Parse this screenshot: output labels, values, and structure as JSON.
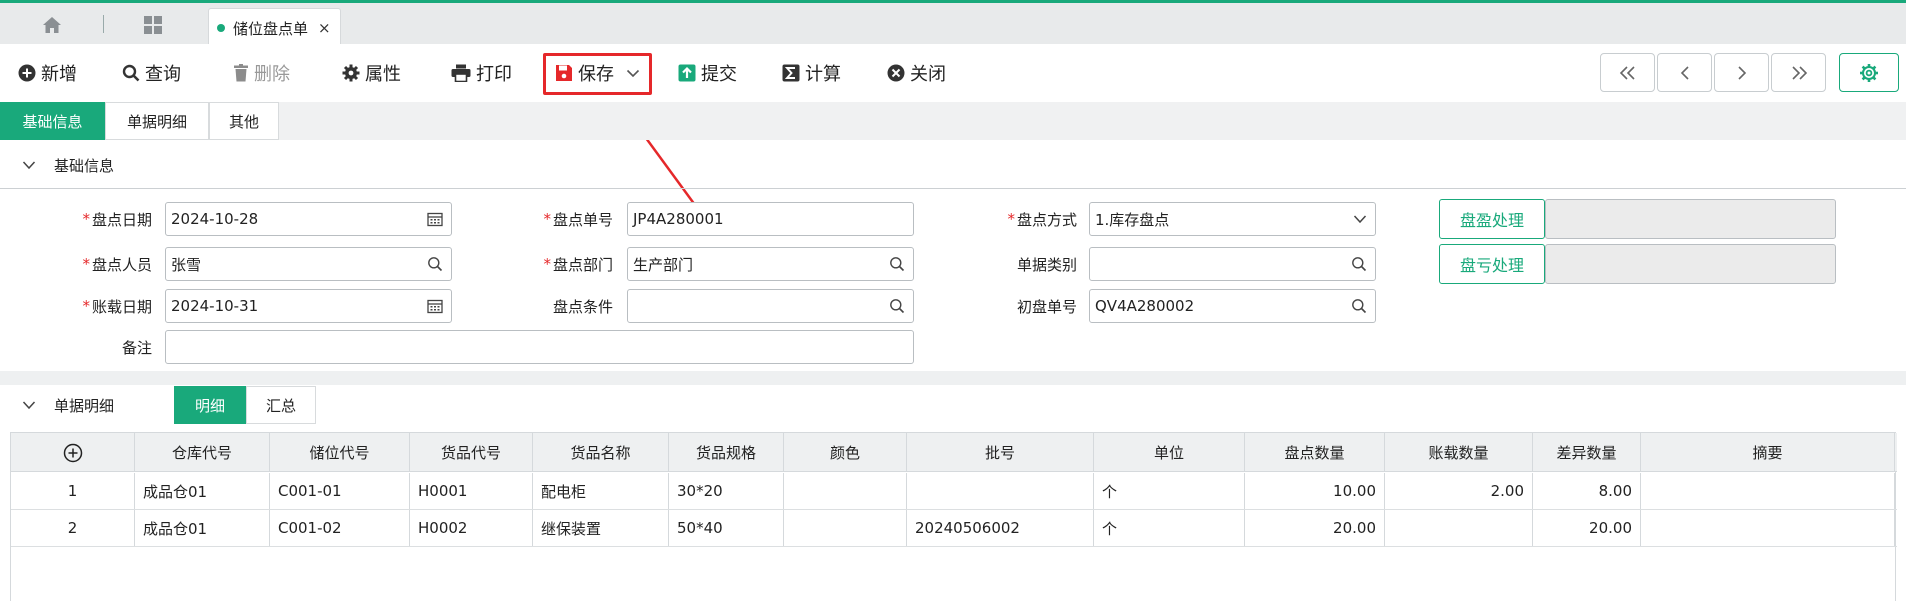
{
  "tabs": {
    "doc_tab_label": "储位盘点单",
    "close_glyph": "×"
  },
  "toolbar": {
    "add": "新增",
    "query": "查询",
    "delete": "删除",
    "properties": "属性",
    "print": "打印",
    "save": "保存",
    "submit": "提交",
    "calculate": "计算",
    "close": "关闭"
  },
  "section_tabs": [
    "基础信息",
    "单据明细",
    "其他"
  ],
  "basic": {
    "header": "基础信息",
    "count_date_label": "盘点日期",
    "count_date": "2024-10-28",
    "count_no_label": "盘点单号",
    "count_no": "JP4A280001",
    "count_method_label": "盘点方式",
    "count_method": "1.库存盘点",
    "counter_label": "盘点人员",
    "counter": "张雪",
    "dept_label": "盘点部门",
    "dept": "生产部门",
    "doc_type_label": "单据类别",
    "doc_type": "",
    "book_date_label": "账载日期",
    "book_date": "2024-10-31",
    "condition_label": "盘点条件",
    "condition": "",
    "initial_no_label": "初盘单号",
    "initial_no": "QV4A280002",
    "remark_label": "备注",
    "remark": "",
    "gain_button": "盘盈处理",
    "loss_button": "盘亏处理"
  },
  "detail": {
    "header": "单据明细",
    "tabs": [
      "明细",
      "汇总"
    ],
    "columns": [
      "仓库代号",
      "储位代号",
      "货品代号",
      "货品名称",
      "货品规格",
      "颜色",
      "批号",
      "单位",
      "盘点数量",
      "账载数量",
      "差异数量",
      "摘要"
    ],
    "rows": [
      {
        "no": "1",
        "wh": "成品仓01",
        "loc": "C001-01",
        "code": "H0001",
        "name": "配电柜",
        "spec": "30*20",
        "color": "",
        "batch": "",
        "unit": "个",
        "count_qty": "10.00",
        "book_qty": "2.00",
        "diff_qty": "8.00",
        "memo": ""
      },
      {
        "no": "2",
        "wh": "成品仓01",
        "loc": "C001-02",
        "code": "H0002",
        "name": "继保装置",
        "spec": "50*40",
        "color": "",
        "batch": "20240506002",
        "unit": "个",
        "count_qty": "20.00",
        "book_qty": "",
        "diff_qty": "20.00",
        "memo": ""
      }
    ]
  },
  "colors": {
    "accent": "#19a97b",
    "highlight": "#e5282a"
  }
}
